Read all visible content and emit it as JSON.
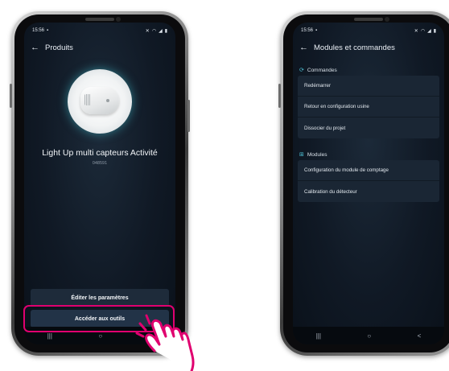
{
  "left_phone": {
    "status_time": "15:56",
    "status_icons": [
      "mute-icon",
      "wifi-icon",
      "signal-icon",
      "battery-icon"
    ],
    "title": "Produits",
    "product_name": "Light Up multi capteurs Activité",
    "product_code": "048591",
    "buttons": {
      "edit": "Éditer les paramètres",
      "tools": "Accéder aux outils"
    },
    "nav": [
      "|||",
      "○",
      "<"
    ]
  },
  "right_phone": {
    "status_time": "15:56",
    "title": "Modules et commandes",
    "sections": [
      {
        "title": "Commandes",
        "icon": "commands-icon",
        "items": [
          "Redémarrer",
          "Retour en configuration usine",
          "Dissocier du projet"
        ]
      },
      {
        "title": "Modules",
        "icon": "modules-icon",
        "items": [
          "Configuration du module de comptage",
          "Calibration du détecteur"
        ]
      }
    ],
    "nav": [
      "|||",
      "○",
      "<"
    ]
  },
  "colors": {
    "accent_highlight": "#e0006f",
    "accent_teal": "#41c5d3",
    "screen_bg": "#101925",
    "card_bg": "#1a2634"
  }
}
